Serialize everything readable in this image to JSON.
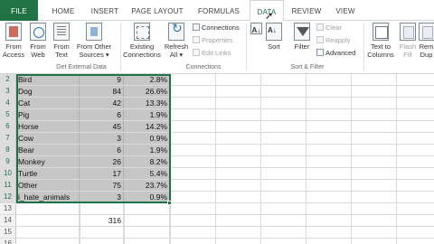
{
  "tabs": [
    {
      "label": "FILE",
      "kind": "file"
    },
    {
      "label": "HOME",
      "kind": "normal"
    },
    {
      "label": "INSERT",
      "kind": "normal"
    },
    {
      "label": "PAGE LAYOUT",
      "kind": "normal"
    },
    {
      "label": "FORMULAS",
      "kind": "normal"
    },
    {
      "label": "DATA",
      "kind": "active"
    },
    {
      "label": "REVIEW",
      "kind": "normal"
    },
    {
      "label": "VIEW",
      "kind": "normal"
    }
  ],
  "ribbon": {
    "get_external_data": {
      "group_label": "Get External Data",
      "from_access": [
        "From",
        "Access"
      ],
      "from_web": [
        "From",
        "Web"
      ],
      "from_text": [
        "From",
        "Text"
      ],
      "from_other": [
        "From Other",
        "Sources ▾"
      ]
    },
    "connections": {
      "group_label": "Connections",
      "existing": [
        "Existing",
        "Connections"
      ],
      "refresh": [
        "Refresh",
        "All ▾"
      ],
      "connections_link": "Connections",
      "properties": "Properties",
      "edit_links": "Edit Links"
    },
    "sort_filter": {
      "group_label": "Sort & Filter",
      "sort": "Sort",
      "filter": "Filter",
      "clear": "Clear",
      "reapply": "Reapply",
      "advanced": "Advanced"
    },
    "data_tools": {
      "text_to_columns": [
        "Text to",
        "Columns"
      ],
      "flash_fill": [
        "Flash",
        "Fill"
      ],
      "remove_duplicates": [
        "Rem",
        "Dup"
      ]
    }
  },
  "rows": [
    {
      "num": "2",
      "name": "Bird",
      "count": "9",
      "pct": "2.8%"
    },
    {
      "num": "3",
      "name": "Dog",
      "count": "84",
      "pct": "26.6%"
    },
    {
      "num": "4",
      "name": "Cat",
      "count": "42",
      "pct": "13.3%"
    },
    {
      "num": "5",
      "name": "Pig",
      "count": "6",
      "pct": "1.9%"
    },
    {
      "num": "6",
      "name": "Horse",
      "count": "45",
      "pct": "14.2%"
    },
    {
      "num": "7",
      "name": "Cow",
      "count": "3",
      "pct": "0.9%"
    },
    {
      "num": "8",
      "name": "Bear",
      "count": "6",
      "pct": "1.9%"
    },
    {
      "num": "9",
      "name": "Monkey",
      "count": "26",
      "pct": "8.2%"
    },
    {
      "num": "10",
      "name": "Turtle",
      "count": "17",
      "pct": "5.4%"
    },
    {
      "num": "11",
      "name": "Other",
      "count": "75",
      "pct": "23.7%"
    },
    {
      "num": "12",
      "name": "i_hate_animals",
      "count": "3",
      "pct": "0.9%"
    },
    {
      "num": "13",
      "name": "",
      "count": "",
      "pct": ""
    },
    {
      "num": "14",
      "name": "",
      "count": "316",
      "pct": ""
    },
    {
      "num": "15",
      "name": "",
      "count": "",
      "pct": ""
    },
    {
      "num": "16",
      "name": "",
      "count": "",
      "pct": ""
    }
  ],
  "colors": {
    "accent": "#217346",
    "selection": "#c6c6c6",
    "header_bg": "#f1f1f1"
  }
}
